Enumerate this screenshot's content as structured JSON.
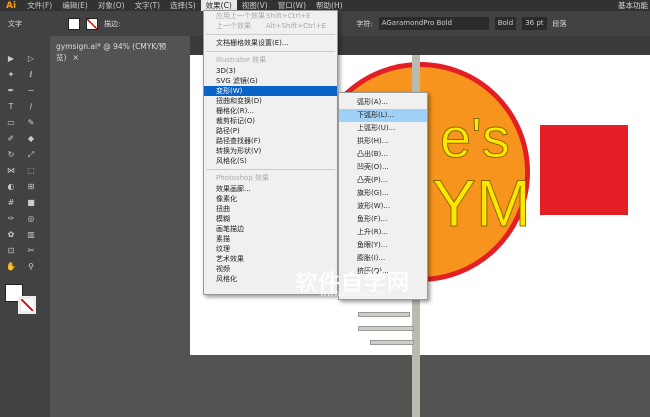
{
  "menubar": {
    "logo": "Ai",
    "items": [
      "文件(F)",
      "编辑(E)",
      "对象(O)",
      "文字(T)",
      "选择(S)",
      "效果(C)",
      "视图(V)",
      "窗口(W)",
      "帮助(H)"
    ],
    "workspace": "基本功能"
  },
  "control": {
    "label": "文字",
    "stroke_label": "描边:",
    "char_label": "字符:",
    "font": "AGaramondPro Bold",
    "style": "Bold",
    "size": "36 pt",
    "para_label": "段落"
  },
  "tab": {
    "title": "gymsign.ai* @ 94% (CMYK/预览)",
    "close": "×"
  },
  "effect_menu": {
    "apply_last": "应用上一个效果",
    "apply_last_sc": "Shift+Ctrl+E",
    "last": "上一个效果",
    "last_sc": "Alt+Shift+Ctrl+E",
    "raster_settings": "文档栅格效果设置(E)...",
    "illustrator_header": "Illustrator 效果",
    "illustrator_items": [
      "3D(3)",
      "SVG 滤镜(G)",
      "变形(W)",
      "扭曲和变换(D)",
      "栅格化(R)...",
      "裁剪标记(O)",
      "路径(P)",
      "路径查找器(F)",
      "转换为形状(V)",
      "风格化(S)"
    ],
    "photoshop_header": "Photoshop 效果",
    "photoshop_items": [
      "效果画廊...",
      "像素化",
      "扭曲",
      "模糊",
      "画笔描边",
      "素描",
      "纹理",
      "艺术效果",
      "视频",
      "风格化"
    ]
  },
  "warp_submenu": {
    "items": [
      "弧形(A)...",
      "下弧形(L)...",
      "上弧形(U)...",
      "拱形(H)...",
      "凸出(B)...",
      "凹壳(O)...",
      "凸壳(P)...",
      "旗形(G)...",
      "波形(W)...",
      "鱼形(F)...",
      "上升(R)...",
      "鱼眼(Y)...",
      "膨胀(I)...",
      "挤压(Q)..."
    ],
    "highlighted": 1
  },
  "artwork": {
    "text1": "e's",
    "text2": "YM"
  },
  "watermark": {
    "text": "软件自学网",
    "url": "WWW.RJZXW.COM"
  }
}
